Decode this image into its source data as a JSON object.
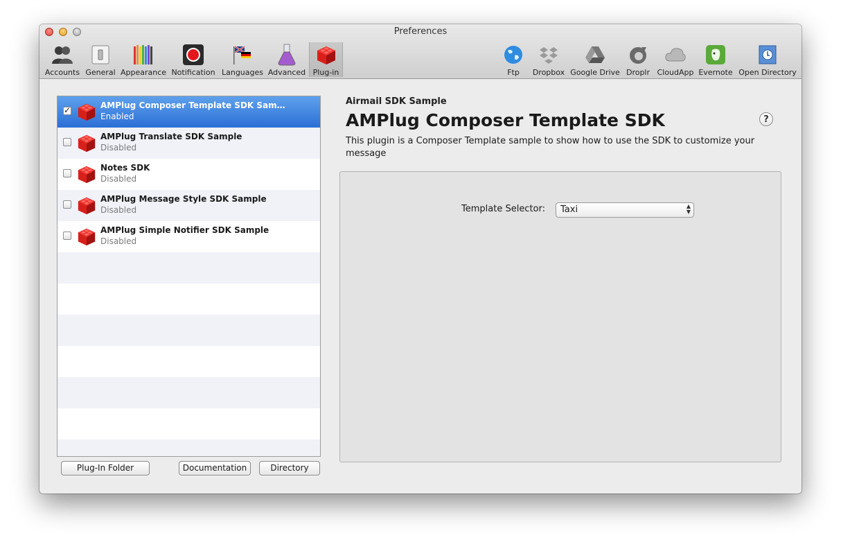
{
  "window": {
    "title": "Preferences"
  },
  "toolbar": {
    "left_items": [
      {
        "label": "Accounts",
        "icon": "accounts-icon"
      },
      {
        "label": "General",
        "icon": "general-icon"
      },
      {
        "label": "Appearance",
        "icon": "appearance-icon"
      },
      {
        "label": "Notification",
        "icon": "notification-icon"
      },
      {
        "label": "Languages",
        "icon": "languages-icon"
      },
      {
        "label": "Advanced",
        "icon": "advanced-icon"
      },
      {
        "label": "Plug-in",
        "icon": "plugin-icon",
        "selected": true
      }
    ],
    "right_items": [
      {
        "label": "Ftp",
        "icon": "ftp-icon"
      },
      {
        "label": "Dropbox",
        "icon": "dropbox-icon"
      },
      {
        "label": "Google Drive",
        "icon": "google-drive-icon"
      },
      {
        "label": "Droplr",
        "icon": "droplr-icon"
      },
      {
        "label": "CloudApp",
        "icon": "cloudapp-icon"
      },
      {
        "label": "Evernote",
        "icon": "evernote-icon"
      },
      {
        "label": "Open Directory",
        "icon": "open-directory-icon"
      }
    ]
  },
  "plugins": [
    {
      "name": "AMPlug Composer Template SDK Sam…",
      "status": "Enabled",
      "checked": true,
      "selected": true
    },
    {
      "name": "AMPlug Translate SDK Sample",
      "status": "Disabled",
      "checked": false
    },
    {
      "name": "Notes SDK",
      "status": "Disabled",
      "checked": false
    },
    {
      "name": "AMPlug Message Style SDK Sample",
      "status": "Disabled",
      "checked": false
    },
    {
      "name": "AMPlug Simple Notifier SDK Sample",
      "status": "Disabled",
      "checked": false
    }
  ],
  "buttons": {
    "plugin_folder": "Plug-In Folder",
    "documentation": "Documentation",
    "directory": "Directory"
  },
  "details": {
    "supertitle": "Airmail SDK Sample",
    "title": "AMPlug Composer Template SDK",
    "description": "This plugin is a Composer Template sample to show how to use the SDK to customize your message",
    "help_label": "?",
    "template_selector_label": "Template Selector:",
    "template_selector_value": "Taxi"
  },
  "colors": {
    "selection": "#2b6fd6",
    "brick_red": "#d8201b",
    "alt_row": "#f0f2f8"
  }
}
